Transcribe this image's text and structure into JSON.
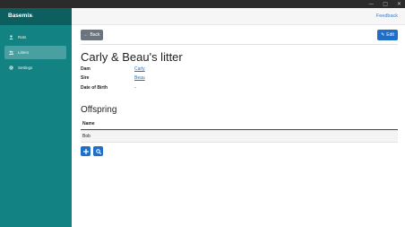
{
  "app": {
    "name": "Basemix",
    "badge": "%",
    "window_controls": [
      "—",
      "□",
      "✕"
    ]
  },
  "sidebar": {
    "items": [
      {
        "label": "Rats",
        "icon": "person-icon",
        "active": false
      },
      {
        "label": "Litters",
        "icon": "people-icon",
        "active": true
      },
      {
        "label": "Settings",
        "icon": "gear-icon",
        "active": false
      }
    ]
  },
  "header": {
    "feedback": "Feedback"
  },
  "toolbar": {
    "back_label": "Back",
    "back_icon": "←",
    "edit_label": "Edit",
    "edit_icon": "✎"
  },
  "litter": {
    "title": "Carly & Beau's litter",
    "fields": [
      {
        "label": "Dam",
        "value": "Carly",
        "link": true
      },
      {
        "label": "Sire",
        "value": "Beau",
        "link": true
      },
      {
        "label": "Date of Birth",
        "value": "-",
        "link": false
      }
    ]
  },
  "offspring": {
    "title": "Offspring",
    "header": "Name",
    "rows": [
      "Bob"
    ]
  },
  "colors": {
    "sidebar": "#128282",
    "brand": "#0d5e5e",
    "primary": "#1f6fc9",
    "secondary": "#6c757d"
  }
}
